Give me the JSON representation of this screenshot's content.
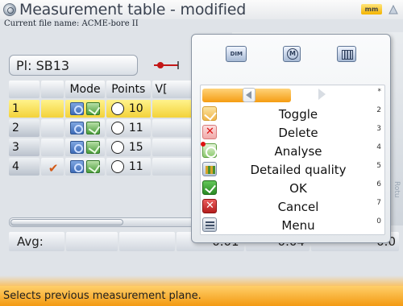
{
  "window": {
    "title": "Measurement table - modified",
    "unit_badge": "mm",
    "filename_text": "Current file name: ACME-bore II"
  },
  "plane": {
    "label": "Pl: SB13"
  },
  "table": {
    "headers": {
      "mode": "Mode",
      "points": "Points",
      "value": "V["
    },
    "rows": [
      {
        "index": "1",
        "checked": false,
        "points": "10",
        "selected": true
      },
      {
        "index": "2",
        "checked": false,
        "points": "11",
        "selected": false
      },
      {
        "index": "3",
        "checked": false,
        "points": "15",
        "selected": false
      },
      {
        "index": "4",
        "checked": true,
        "points": "11",
        "selected": false
      }
    ]
  },
  "avg": {
    "label": "Avg:",
    "v1": "0.01",
    "v2": "0.04",
    "v3": "0.0"
  },
  "menu": {
    "toolbar": {
      "dim_label": "DIM"
    },
    "nav_key": "*",
    "items": [
      {
        "label": "Toggle",
        "key": "2",
        "icon": "toggle-icon"
      },
      {
        "label": "Delete",
        "key": "3",
        "icon": "delete-icon"
      },
      {
        "label": "Analyse",
        "key": "4",
        "icon": "analyse-icon"
      },
      {
        "label": "Detailed quality",
        "key": "5",
        "icon": "quality-icon"
      },
      {
        "label": "OK",
        "key": "6",
        "icon": "ok-icon"
      },
      {
        "label": "Cancel",
        "key": "7",
        "icon": "cancel-icon"
      },
      {
        "label": "Menu",
        "key": "0",
        "icon": "menu-icon"
      }
    ]
  },
  "side_text": "Rotu",
  "status": {
    "text": "Selects previous measurement plane."
  },
  "colors": {
    "accent": "#f59c12",
    "selection": "#f3d23a"
  }
}
